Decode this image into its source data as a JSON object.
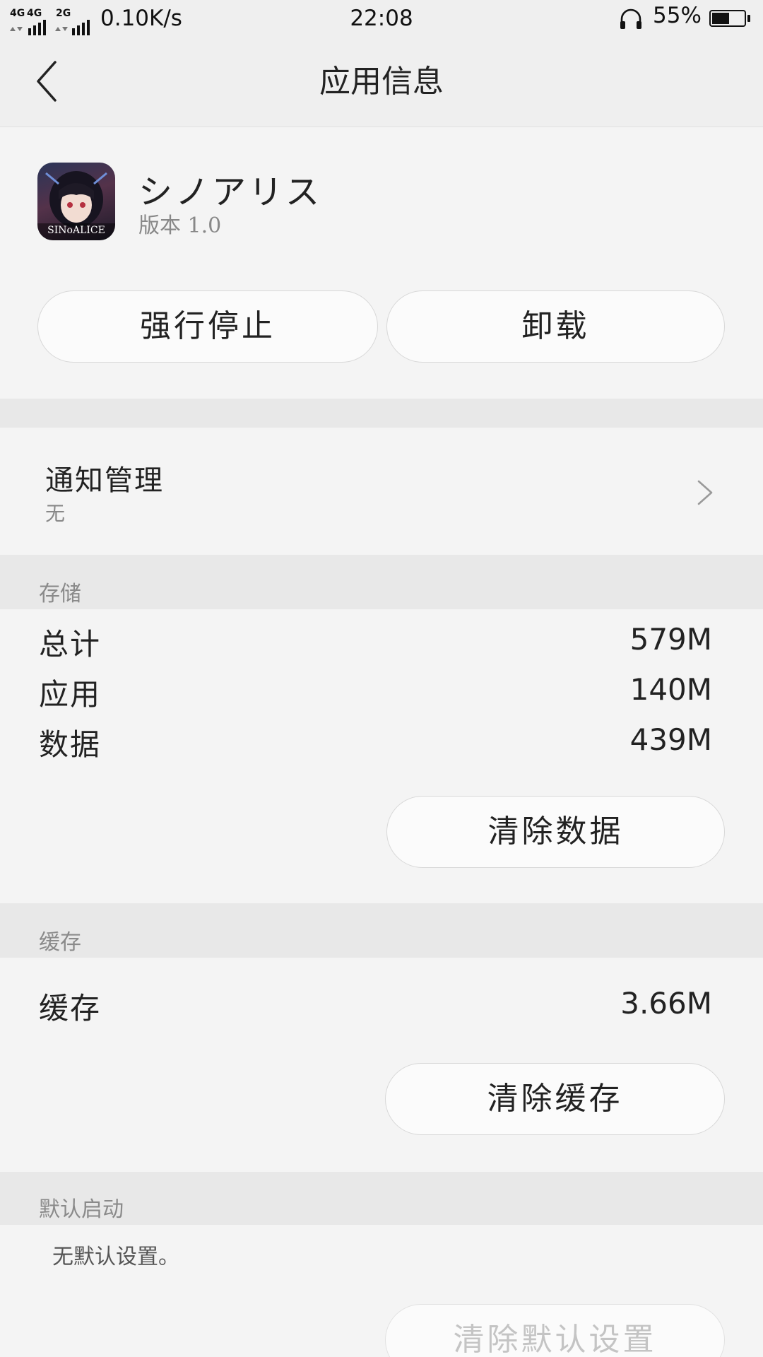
{
  "status_bar": {
    "network_1": "4G",
    "network_2": "4G",
    "network_3": "2G",
    "speed": "0.10K/s",
    "time": "22:08",
    "battery_percent": "55%",
    "battery_level": 0.55,
    "icons": [
      "signal-icon",
      "headphone-icon",
      "battery-icon"
    ]
  },
  "header": {
    "title": "应用信息"
  },
  "app": {
    "name": "シノアリス",
    "version_label": "版本 1.0",
    "icon_text": "SINoALICE",
    "buttons": {
      "force_stop": "强行停止",
      "uninstall": "卸载"
    }
  },
  "notification": {
    "title": "通知管理",
    "value": "无"
  },
  "storage": {
    "section_label": "存储",
    "rows": [
      {
        "label": "总计",
        "value": "579M"
      },
      {
        "label": "应用",
        "value": "140M"
      },
      {
        "label": "数据",
        "value": "439M"
      }
    ],
    "clear_button": "清除数据"
  },
  "cache": {
    "section_label": "缓存",
    "row": {
      "label": "缓存",
      "value": "3.66M"
    },
    "clear_button": "清除缓存"
  },
  "default_launch": {
    "section_label": "默认启动",
    "message": "无默认设置。",
    "clear_button": "清除默认设置"
  },
  "colors": {
    "background": "#f4f4f4",
    "band": "#e8e8e8",
    "text": "#222222",
    "secondary": "#888888"
  }
}
